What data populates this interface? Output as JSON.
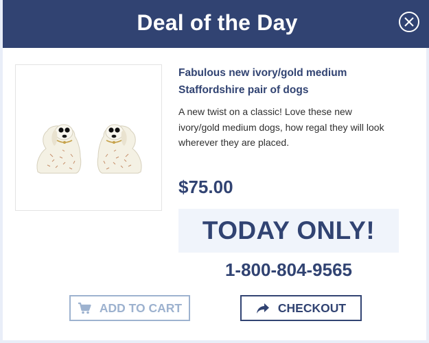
{
  "header": {
    "title": "Deal of the Day"
  },
  "product": {
    "title": "Fabulous new ivory/gold medium Staffordshire pair of dogs",
    "description": "A new twist on a classic! Love these new ivory/gold medium dogs, how regal they will look wherever they are placed.",
    "price": "$75.00",
    "image_icon": "staffordshire-dogs-image"
  },
  "promo": {
    "today_only": "TODAY ONLY!",
    "phone": "1-800-804-9565"
  },
  "actions": {
    "add_to_cart": {
      "label": "ADD TO CART",
      "icon": "cart-icon"
    },
    "checkout": {
      "label": "CHECKOUT",
      "icon": "share-arrow-icon"
    }
  },
  "colors": {
    "brand_navy": "#314372",
    "light_blue": "#9db2cf",
    "promo_bg": "#f0f4fb"
  }
}
